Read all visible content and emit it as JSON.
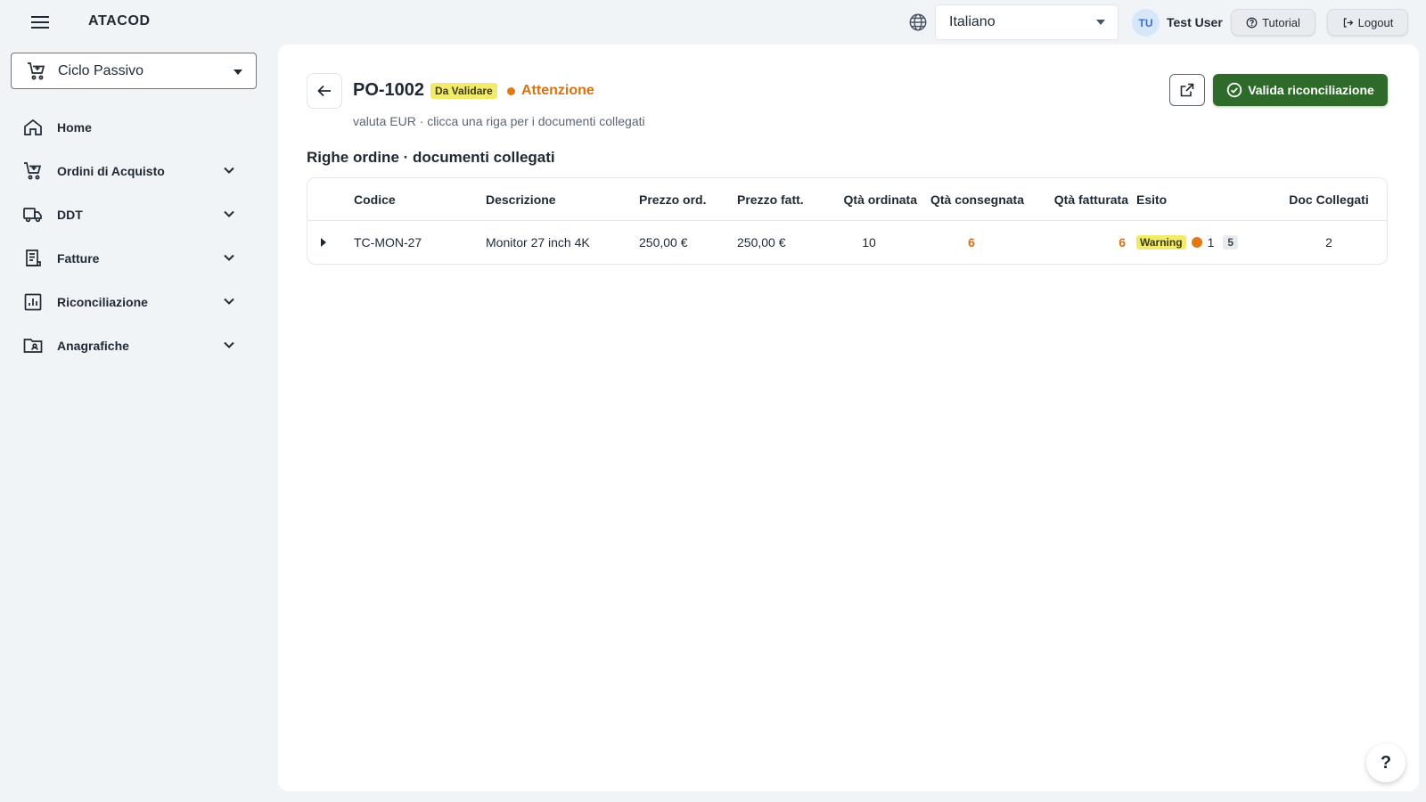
{
  "header": {
    "app_title": "ATACOD",
    "language": "Italiano",
    "user_initials": "TU",
    "user_name": "Test User",
    "tutorial_label": "Tutorial",
    "logout_label": "Logout"
  },
  "sidebar": {
    "module": "Ciclo Passivo",
    "items": [
      {
        "label": "Home",
        "icon": "home-icon"
      },
      {
        "label": "Ordini di Acquisto",
        "icon": "cart-icon"
      },
      {
        "label": "DDT",
        "icon": "truck-icon"
      },
      {
        "label": "Fatture",
        "icon": "receipt-icon"
      },
      {
        "label": "Riconciliazione",
        "icon": "chart-icon"
      },
      {
        "label": "Anagrafiche",
        "icon": "contact-folder-icon"
      }
    ]
  },
  "main": {
    "po_number": "PO-1002",
    "status": "Da Validare",
    "attention": "Attenzione",
    "subtitle": "valuta EUR · clicca una riga per i documenti collegati",
    "validate_label": "Valida riconciliazione",
    "section_title": "Righe ordine · documenti collegati",
    "table": {
      "columns": [
        "Codice",
        "Descrizione",
        "Prezzo ord.",
        "Prezzo fatt.",
        "Qtà ordinata",
        "Qtà consegnata",
        "Qtà fatturata",
        "Esito",
        "Doc Collegati"
      ],
      "rows": [
        {
          "codice": "TC-MON-27",
          "descrizione": "Monitor 27 inch 4K",
          "prezzo_ord": "250,00 €",
          "prezzo_fatt": "250,00 €",
          "qta_ordinata": "10",
          "qta_consegnata": "6",
          "qta_fatturata": "6",
          "esito": "Warning",
          "esito_count": "1",
          "esito_total": "5",
          "doc_collegati": "2"
        }
      ]
    }
  },
  "help_label": "?",
  "colors": {
    "accent_green": "#2e6b2a",
    "warning_orange": "#e27a13",
    "badge_yellow": "#f2ea6a"
  }
}
